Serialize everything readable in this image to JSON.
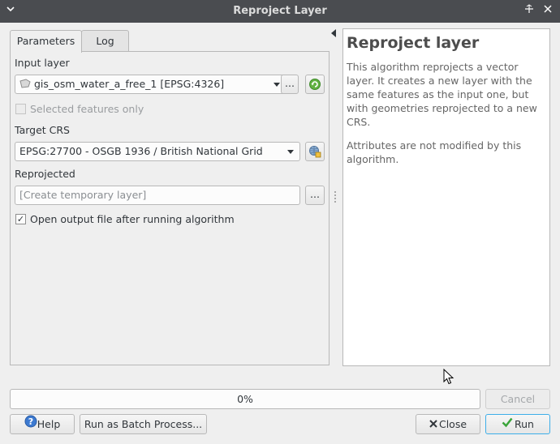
{
  "window": {
    "title": "Reproject Layer"
  },
  "tabs": [
    {
      "label": "Parameters",
      "active": true
    },
    {
      "label": "Log",
      "active": false
    }
  ],
  "params": {
    "input_layer_label": "Input layer",
    "input_layer_value": "gis_osm_water_a_free_1 [EPSG:4326]",
    "selected_only_label": "Selected features only",
    "selected_only_checked": false,
    "target_crs_label": "Target CRS",
    "target_crs_value": "EPSG:27700 - OSGB 1936 / British National Grid",
    "reprojected_label": "Reprojected",
    "reprojected_placeholder": "[Create temporary layer]",
    "open_output_label": "Open output file after running algorithm",
    "open_output_checked": true,
    "browse_label": "..."
  },
  "help": {
    "title": "Reproject layer",
    "paragraph1": "This algorithm reprojects a vector layer. It creates a new layer with the same features as the input one, but with geometries reprojected to a new CRS.",
    "paragraph2": "Attributes are not modified by this algorithm."
  },
  "progress": {
    "value": 0,
    "text": "0%"
  },
  "buttons": {
    "cancel": "Cancel",
    "help": "Help",
    "batch": "Run as Batch Process...",
    "close": "Close",
    "run": "Run"
  },
  "colors": {
    "titlebar": "#4a4c50",
    "run_check": "#3aa43a",
    "help_icon": "#3d7ad1"
  }
}
